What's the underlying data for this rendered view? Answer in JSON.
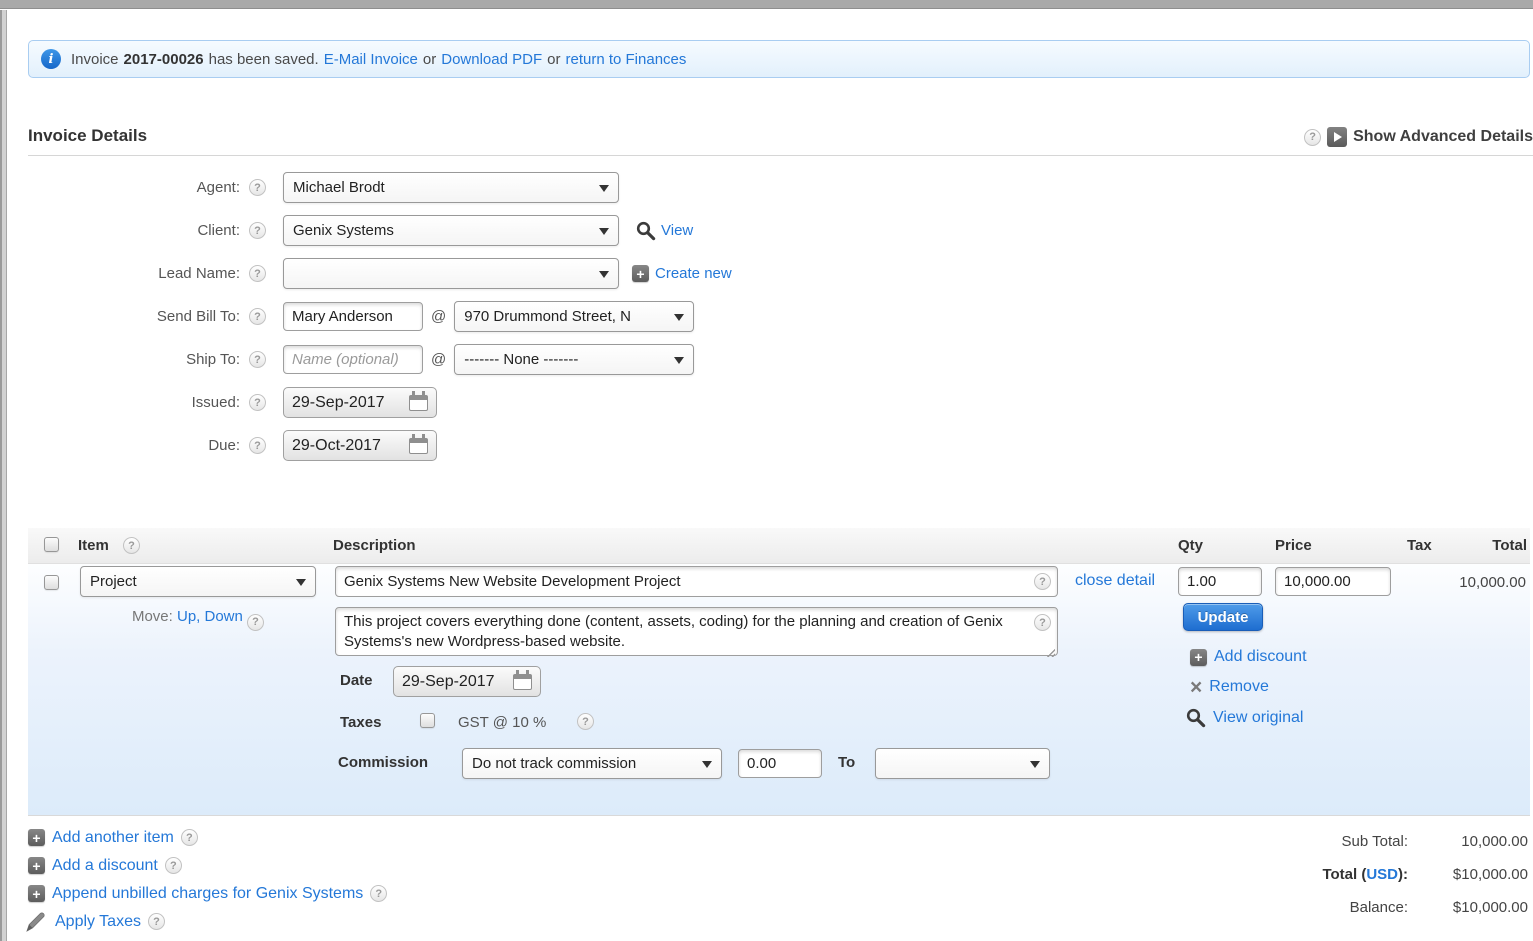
{
  "colors": {
    "link_blue": "#2478d8",
    "button_blue": "#2e7fd9",
    "panel_blue": "#dcebfa",
    "notification_bg": "#e9f3fc"
  },
  "icons": {
    "help": "?",
    "plus": "+",
    "info": "i",
    "remove_x": "×"
  },
  "notification": {
    "prefix": "Invoice",
    "invoice_number": "2017-00026",
    "suffix": "has been saved.",
    "email_link": "E-Mail Invoice",
    "or_1": "or",
    "download_link": "Download PDF",
    "or_2": "or",
    "finances_link": "return to Finances"
  },
  "header": {
    "title": "Invoice Details",
    "advanced_toggle": "Show Advanced Details"
  },
  "form": {
    "agent": {
      "label": "Agent:",
      "value": "Michael Brodt"
    },
    "client": {
      "label": "Client:",
      "value": "Genix Systems",
      "view_link": "View"
    },
    "lead": {
      "label": "Lead Name:",
      "value": "",
      "create_link": "Create new"
    },
    "send_bill_to": {
      "label": "Send Bill To:",
      "name": "Mary Anderson",
      "at": "@",
      "address": "970 Drummond Street, N"
    },
    "ship_to": {
      "label": "Ship To:",
      "name_placeholder": "Name (optional)",
      "at": "@",
      "address": "------- None -------"
    },
    "issued": {
      "label": "Issued:",
      "value": "29-Sep-2017"
    },
    "due": {
      "label": "Due:",
      "value": "29-Oct-2017"
    }
  },
  "items_table": {
    "headers": {
      "item": "Item",
      "description": "Description",
      "qty": "Qty",
      "price": "Price",
      "tax": "Tax",
      "total": "Total"
    },
    "row": {
      "item_type": "Project",
      "move_label": "Move:",
      "move_up": "Up,",
      "move_down": "Down",
      "description": "Genix Systems New Website Development Project",
      "close_detail_link": "close detail",
      "qty": "1.00",
      "price": "10,000.00",
      "total": "10,000.00",
      "update_button": "Update",
      "add_discount_link": "Add discount",
      "remove_link": "Remove",
      "view_original_link": "View original",
      "detail_description": "This project covers everything done (content, assets, coding) for the planning and creation of Genix Systems's new Wordpress-based website.",
      "date_label": "Date",
      "date_value": "29-Sep-2017",
      "taxes_label": "Taxes",
      "tax_option": "GST @ 10 %",
      "commission_label": "Commission",
      "commission_option": "Do not track commission",
      "commission_value": "0.00",
      "to_label": "To"
    }
  },
  "actions": {
    "add_another_item": "Add another item",
    "add_a_discount": "Add a discount",
    "append_unbilled": "Append unbilled charges for Genix Systems",
    "apply_taxes": "Apply Taxes"
  },
  "totals": {
    "sub_total_label": "Sub Total:",
    "sub_total_value": "10,000.00",
    "total_label_prefix": "Total (",
    "total_currency_link": "USD",
    "total_label_suffix": "):",
    "total_value": "$10,000.00",
    "balance_label": "Balance:",
    "balance_value": "$10,000.00"
  }
}
